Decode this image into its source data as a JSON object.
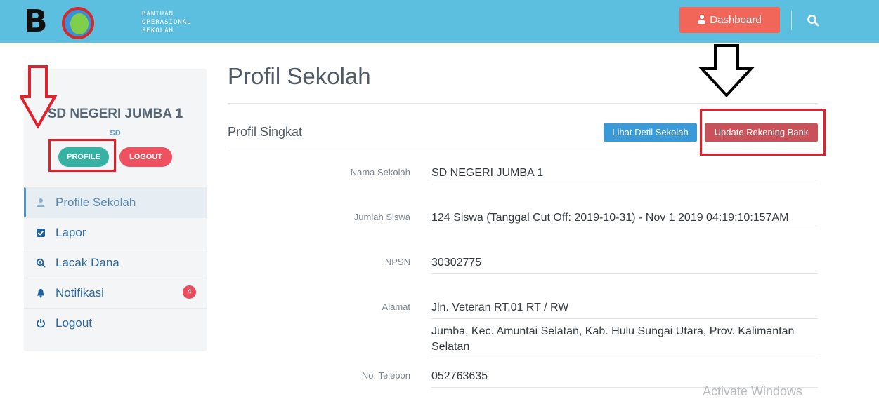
{
  "header": {
    "logo_text": "B  S",
    "logo_subtitle": [
      "BANTUAN",
      "OPERASIONAL",
      "SEKOLAH"
    ],
    "dashboard_label": "Dashboard",
    "search_icon": "search-icon"
  },
  "sidebar": {
    "school_name": "SD NEGERI JUMBA 1",
    "school_level": "SD",
    "profile_label": "PROFILE",
    "logout_pill_label": "LOGOUT",
    "items": [
      {
        "label": "Profile Sekolah",
        "icon": "user-icon",
        "active": true
      },
      {
        "label": "Lapor",
        "icon": "check-square-icon"
      },
      {
        "label": "Lacak Dana",
        "icon": "search-plus-icon"
      },
      {
        "label": "Notifikasi",
        "icon": "bell-icon",
        "badge": "4"
      },
      {
        "label": "Logout",
        "icon": "power-icon"
      }
    ]
  },
  "main": {
    "title": "Profil Sekolah",
    "section_title": "Profil Singkat",
    "detail_button": "Lihat Detil Sekolah",
    "bank_button": "Update Rekening Bank",
    "fields": [
      {
        "label": "Nama Sekolah",
        "value": "SD NEGERI JUMBA 1"
      },
      {
        "label": "Jumlah Siswa",
        "value": "124 Siswa (Tanggal Cut Off: 2019-10-31) - Nov 1 2019 04:19:10:157AM"
      },
      {
        "label": "NPSN",
        "value": "30302775"
      },
      {
        "label": "Alamat",
        "value": "Jln. Veteran RT.01 RT / RW",
        "value2": "Jumba, Kec. Amuntai Selatan, Kab. Hulu Sungai Utara, Prov. Kalimantan Selatan"
      },
      {
        "label": "No. Telepon",
        "value": "052763635"
      }
    ]
  },
  "watermark": "Activate Windows",
  "colors": {
    "topbar": "#5cbfe0",
    "dashboard_button": "#f2665a",
    "detail_button": "#3a9ad9",
    "bank_button": "#c9525a",
    "highlight": "#e0202a"
  }
}
